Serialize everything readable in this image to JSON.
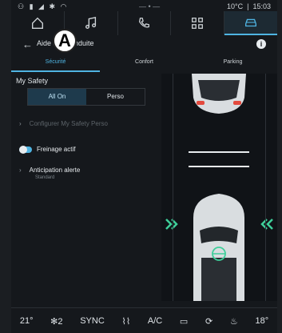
{
  "status": {
    "time": "15:03",
    "temp": "10°C"
  },
  "header": {
    "title": "Aide à la conduite",
    "callout": "A"
  },
  "tabs": [
    {
      "label": "Sécurité"
    },
    {
      "label": "Confort"
    },
    {
      "label": "Parking"
    }
  ],
  "safety": {
    "section_title": "My Safety",
    "seg_all_on": "All On",
    "seg_perso": "Perso",
    "configure": "Configurer My Safety Perso",
    "active_braking": "Freinage actif",
    "alert_anticipation": "Anticipation alerte",
    "alert_value": "Standard"
  },
  "bottom": {
    "temp_left": "21°",
    "fan": "2",
    "sync": "SYNC",
    "ac": "A/C",
    "temp_right": "18°"
  },
  "colors": {
    "accent": "#4fb4e2",
    "accent_green": "#3ecf9a"
  }
}
